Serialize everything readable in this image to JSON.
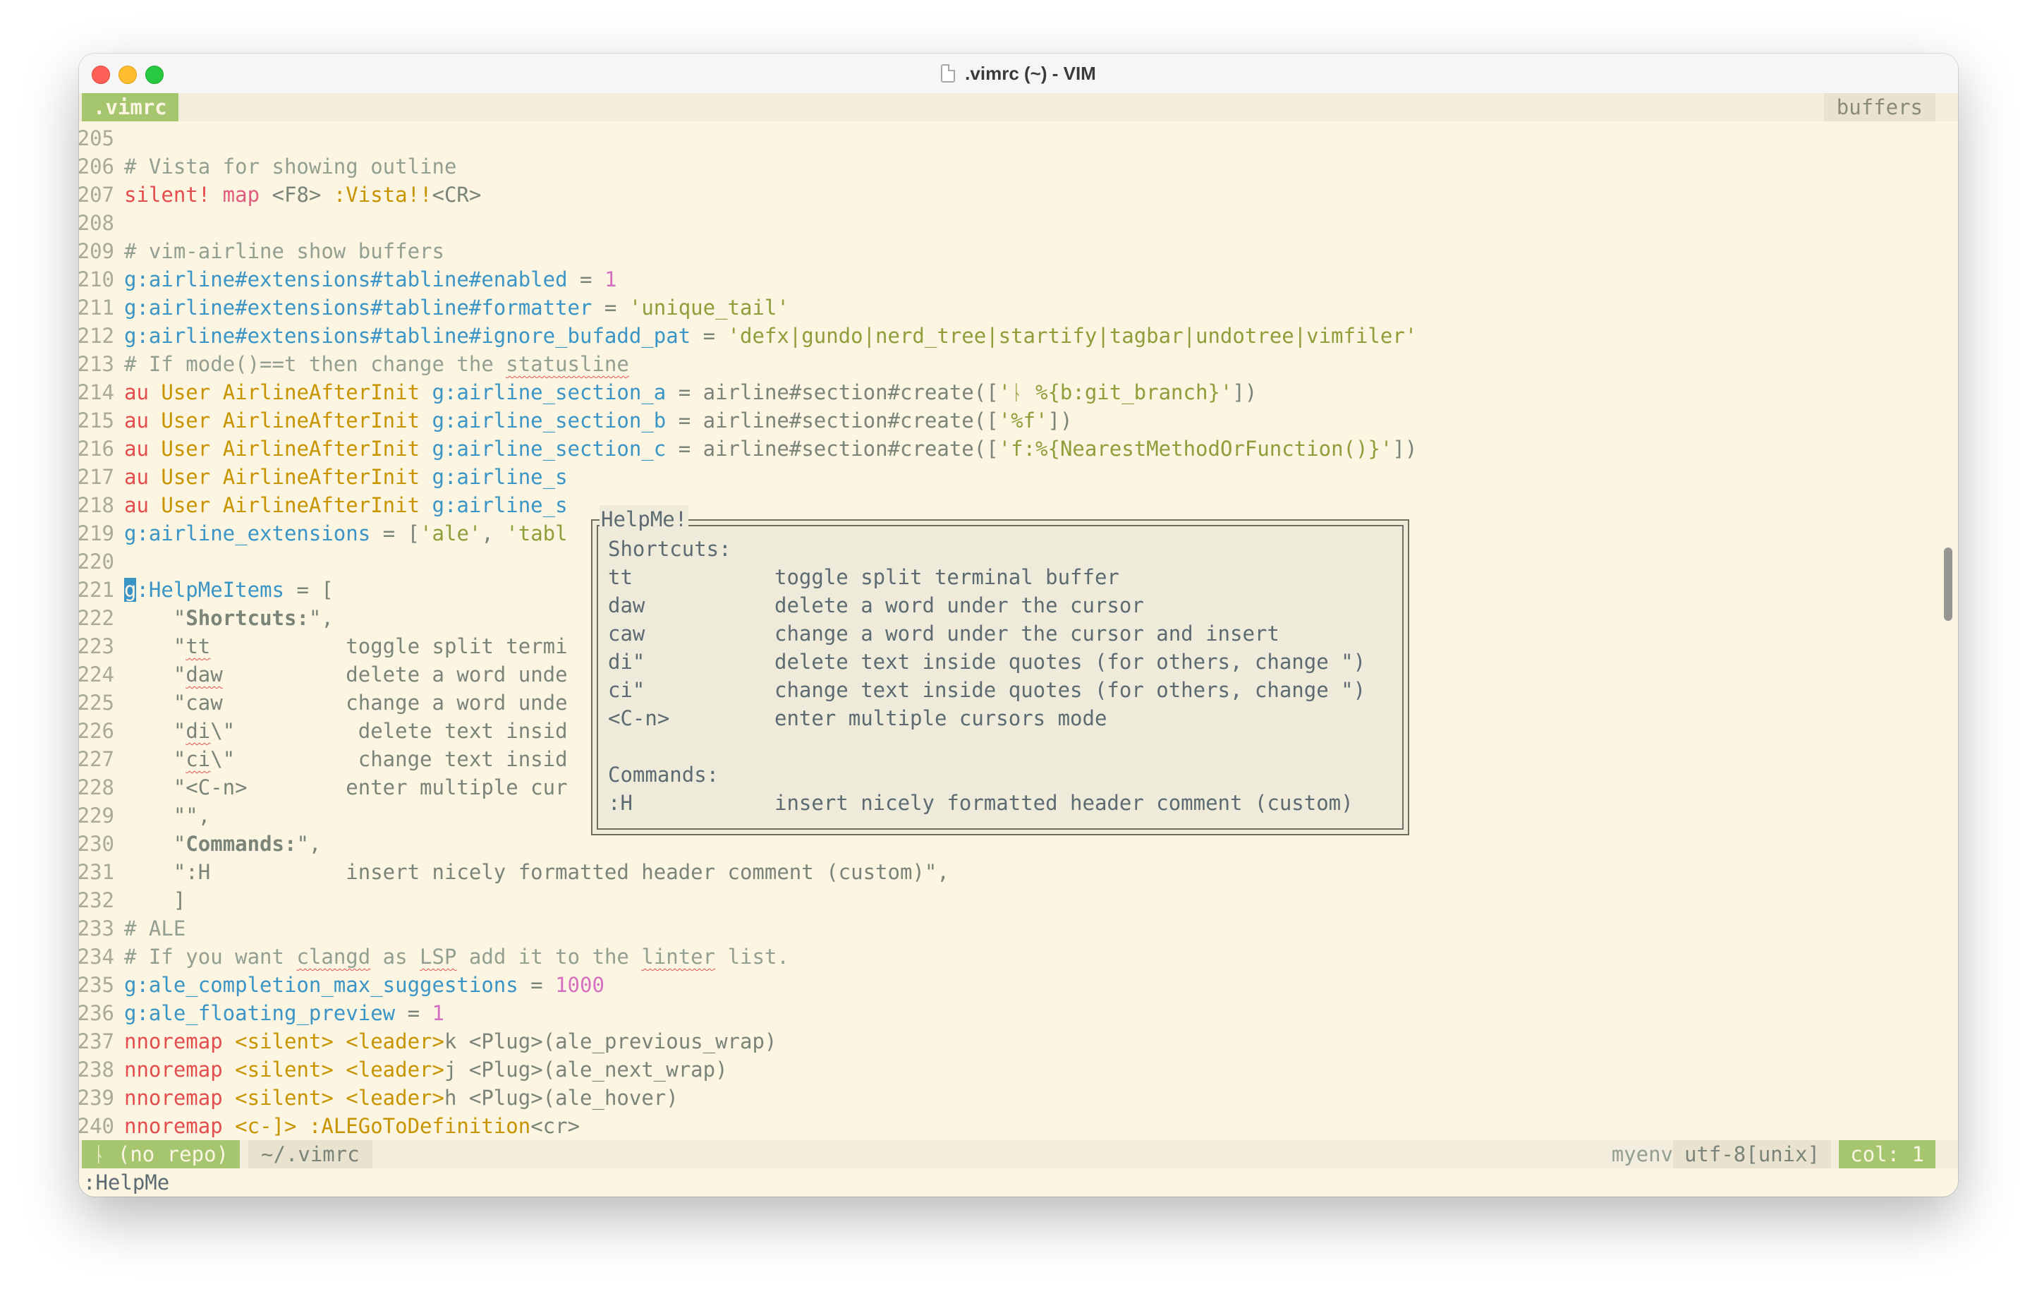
{
  "window": {
    "title": ".vimrc (~) - VIM"
  },
  "tabline": {
    "active_tab": ".vimrc",
    "right_label": "buffers"
  },
  "lines": [
    {
      "n": "205"
    },
    {
      "n": "206",
      "c1": "# Vista for showing outline"
    },
    {
      "n": "207",
      "a": "silent!",
      "b": " map",
      "c": " <F8>",
      "d": " :Vista!!",
      "e": "<CR>"
    },
    {
      "n": "208"
    },
    {
      "n": "209",
      "c1": "# vim-airline show buffers"
    },
    {
      "n": "210",
      "a": "g:airline#extensions#tabline#enabled",
      "b": " = ",
      "c": "1"
    },
    {
      "n": "211",
      "a": "g:airline#extensions#tabline#formatter",
      "b": " = ",
      "c": "'unique_tail'"
    },
    {
      "n": "212",
      "a": "g:airline#extensions#tabline#ignore_bufadd_pat",
      "b": " = ",
      "c": "'defx|gundo|nerd_tree|startify|tagbar|undotree|vimfiler'"
    },
    {
      "n": "213",
      "c1": "# If mode()==t then change the ",
      "c2": "statusline"
    },
    {
      "n": "214",
      "a": "au",
      "b": " User",
      "c": " AirlineAfterInit",
      "d": " g:airline_section_a",
      "e": " = ",
      "f": "airline#section#create",
      "g": "([",
      "h": "'ᚿ %{b:git_branch}'",
      "i": "])"
    },
    {
      "n": "215",
      "a": "au",
      "b": " User",
      "c": " AirlineAfterInit",
      "d": " g:airline_section_b",
      "e": " = ",
      "f": "airline#section#create",
      "g": "([",
      "h": "'%f'",
      "i": "])"
    },
    {
      "n": "216",
      "a": "au",
      "b": " User",
      "c": " AirlineAfterInit",
      "d": " g:airline_section_c",
      "e": " = ",
      "f": "airline#section#create",
      "g": "([",
      "h": "'f:%{NearestMethodOrFunction()}'",
      "i": "])"
    },
    {
      "n": "217",
      "a": "au",
      "b": " User",
      "c": " AirlineAfterInit",
      "d": " g:airline_s"
    },
    {
      "n": "218",
      "a": "au",
      "b": " User",
      "c": " AirlineAfterInit",
      "d": " g:airline_s"
    },
    {
      "n": "219",
      "a": "g:airline_extensions",
      "b": " = ",
      "c": "[",
      "d": "'ale'",
      "e": ", ",
      "f": "'tabl"
    },
    {
      "n": "220"
    },
    {
      "n": "221",
      "a": "g",
      "b": ":HelpMeItems",
      "c": " = ",
      "d": "["
    },
    {
      "n": "222",
      "a": "    \"",
      "b": "Shortcuts:",
      "c": "\","
    },
    {
      "n": "223",
      "a": "    \"",
      "b": "tt",
      "c": "           toggle split termi"
    },
    {
      "n": "224",
      "a": "    \"",
      "b": "daw",
      "c": "          delete a word unde"
    },
    {
      "n": "225",
      "a": "    \"caw          change a word unde"
    },
    {
      "n": "226",
      "a": "    \"",
      "b": "di",
      "c": "\\\"          delete text insid"
    },
    {
      "n": "227",
      "a": "    \"",
      "b": "ci",
      "c": "\\\"          change text insid"
    },
    {
      "n": "228",
      "a": "    \"<C-n>        enter multiple cur"
    },
    {
      "n": "229",
      "a": "    \"\","
    },
    {
      "n": "230",
      "a": "    \"",
      "b": "Commands:",
      "c": "\","
    },
    {
      "n": "231",
      "a": "    \":H           insert nicely formatted header comment (custom)\","
    },
    {
      "n": "232",
      "a": "    ]"
    },
    {
      "n": "233",
      "c1": "# ALE"
    },
    {
      "n": "234",
      "c1": "# If you want ",
      "c2": "clangd",
      "c3": " as ",
      "c4": "LSP",
      "c5": " add it to the ",
      "c6": "linter",
      "c7": " list."
    },
    {
      "n": "235",
      "a": "g:ale_completion_max_suggestions",
      "b": " = ",
      "c": "1000"
    },
    {
      "n": "236",
      "a": "g:ale_floating_preview",
      "b": " = ",
      "c": "1"
    },
    {
      "n": "237",
      "a": "nnoremap",
      "b": " <silent>",
      "c": " <leader>",
      "d": "k ",
      "e": "<Plug>",
      "f": "(ale_previous_wrap)"
    },
    {
      "n": "238",
      "a": "nnoremap",
      "b": " <silent>",
      "c": " <leader>",
      "d": "j ",
      "e": "<Plug>",
      "f": "(ale_next_wrap)"
    },
    {
      "n": "239",
      "a": "nnoremap",
      "b": " <silent>",
      "c": " <leader>",
      "d": "h ",
      "e": "<Plug>",
      "f": "(ale_hover)"
    },
    {
      "n": "240",
      "a": "nnoremap",
      "b": " <c-]>",
      "c": " :ALEGoToDefinition",
      "d": "<cr>"
    }
  ],
  "popup": {
    "title": "HelpMe!",
    "shortcuts_header": "Shortcuts:",
    "shortcuts": [
      {
        "key": "tt",
        "desc": "toggle split terminal buffer"
      },
      {
        "key": "daw",
        "desc": "delete a word under the cursor"
      },
      {
        "key": "caw",
        "desc": "change a word under the cursor and insert"
      },
      {
        "key": "di\"",
        "desc": "delete text inside quotes (for others, change \")"
      },
      {
        "key": "ci\"",
        "desc": "change text inside quotes (for others, change \")"
      },
      {
        "key": "<C-n>",
        "desc": "enter multiple cursors mode"
      }
    ],
    "commands_header": "Commands:",
    "commands": [
      {
        "key": ":H",
        "desc": "insert nicely formatted header comment (custom)"
      }
    ]
  },
  "statusline": {
    "branch": "ᚿ (no repo)",
    "file": "~/.vimrc",
    "env": "myenv",
    "encoding": "utf-8[unix]",
    "column": "col: 1"
  },
  "cmdline": ":HelpMe",
  "colors": {
    "background": "#fbf5e2",
    "accent": "#a6c56f",
    "comment": "#939f91",
    "keyword": "#e05d80"
  }
}
